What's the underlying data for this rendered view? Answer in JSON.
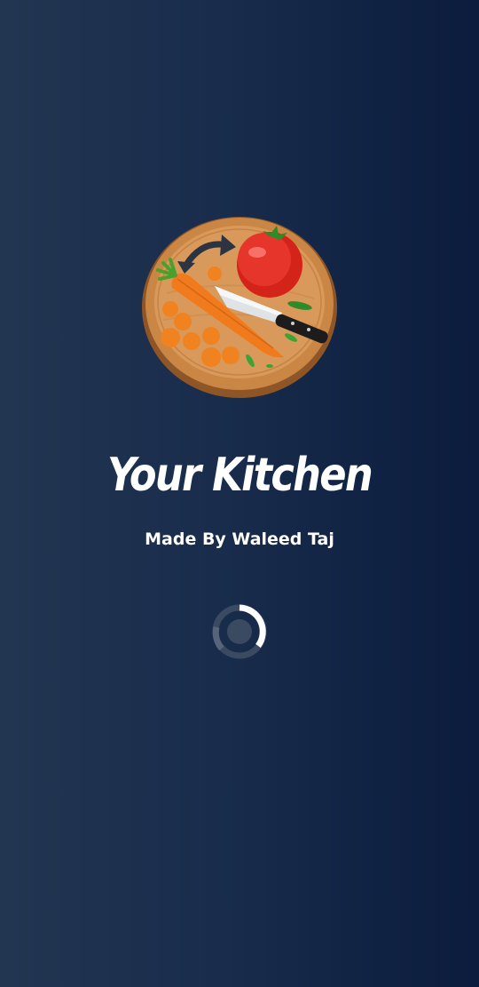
{
  "app": {
    "title": "Your Kitchen",
    "credit": "Made By Waleed Taj"
  },
  "logo": {
    "icon": "cutting-board-icon",
    "board_color": "#c98645",
    "arrow_color": "#2b3440"
  },
  "spinner": {
    "icon": "loading-spinner-icon",
    "track_color": "#3a4a61",
    "active_color": "#ffffff"
  },
  "colors": {
    "background_left": "#223652",
    "background_right": "#0b1c3d",
    "text": "#ffffff"
  }
}
